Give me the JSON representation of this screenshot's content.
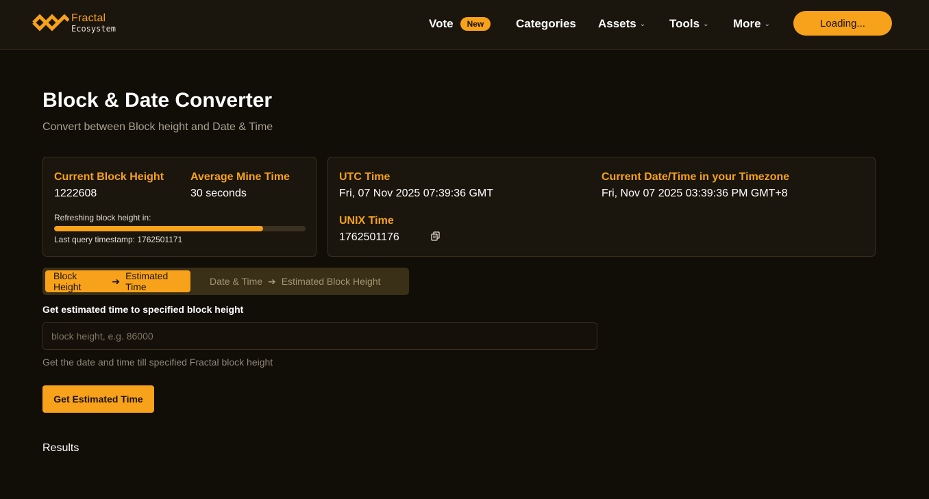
{
  "header": {
    "logo_title": "Fractal",
    "logo_subtitle": "Ecosystem",
    "nav": {
      "vote": "Vote",
      "vote_badge": "New",
      "categories": "Categories",
      "assets": "Assets",
      "tools": "Tools",
      "more": "More"
    },
    "wallet_button": "Loading..."
  },
  "main": {
    "title": "Block & Date Converter",
    "subtitle": "Convert between Block height and Date & Time"
  },
  "stats": {
    "block_height_label": "Current Block Height",
    "block_height_value": "1222608",
    "mine_time_label": "Average Mine Time",
    "mine_time_value": "30 seconds",
    "refresh_label": "Refreshing block height in:",
    "refresh_progress": 0.83,
    "last_query": "Last query timestamp: 1762501171"
  },
  "time": {
    "utc_label": "UTC Time",
    "utc_value": "Fri, 07 Nov 2025 07:39:36 GMT",
    "local_label": "Current Date/Time in your Timezone",
    "local_value": "Fri, Nov 07 2025 03:39:36 PM GMT+8",
    "unix_label": "UNIX Time",
    "unix_value": "1762501176"
  },
  "tabs": [
    {
      "from": "Block Height",
      "to": "Estimated Time",
      "active": true
    },
    {
      "from": "Date & Time",
      "to": "Estimated Block Height",
      "active": false
    }
  ],
  "form": {
    "label": "Get estimated time to specified block height",
    "placeholder": "block height, e.g. 86000",
    "value": "",
    "help": "Get the date and time till specified Fractal block height",
    "submit": "Get Estimated Time"
  },
  "results_heading": "Results",
  "colors": {
    "accent": "#f7a21a",
    "background": "#110d07",
    "card": "#1a150d"
  },
  "icons": {
    "logo": "fractal-logo-icon",
    "chevron": "chevron-down-icon",
    "copy": "copy-icon",
    "arrow": "arrow-right-icon"
  }
}
